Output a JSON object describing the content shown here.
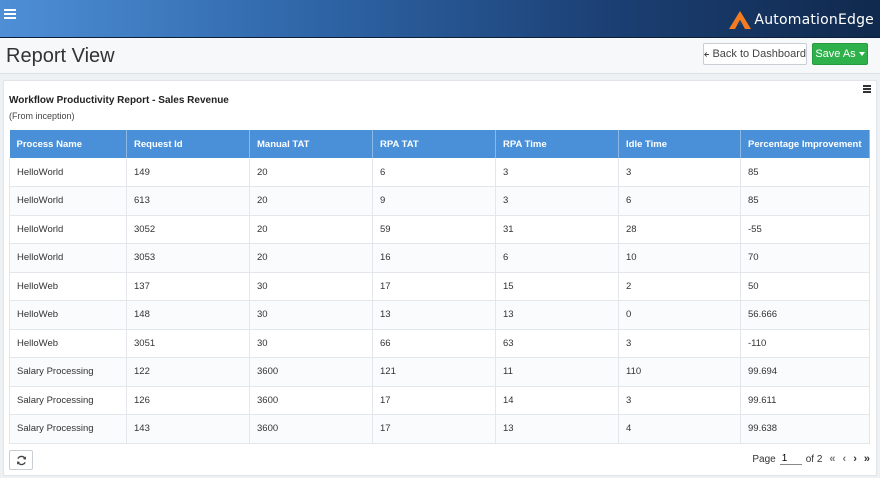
{
  "topbar": {
    "brand": "AutomationEdge",
    "brand_color": "#f47b20"
  },
  "header": {
    "title": "Report View",
    "back_label": "Back to Dashboard",
    "save_label": "Save As"
  },
  "report": {
    "title": "Workflow Productivity Report - Sales Revenue",
    "subtitle": "(From inception)",
    "columns": [
      "Process Name",
      "Request Id",
      "Manual TAT",
      "RPA TAT",
      "RPA Time",
      "Idle Time",
      "Percentage Improvement"
    ],
    "rows": [
      [
        "HelloWorld",
        "149",
        "20",
        "6",
        "3",
        "3",
        "85"
      ],
      [
        "HelloWorld",
        "613",
        "20",
        "9",
        "3",
        "6",
        "85"
      ],
      [
        "HelloWorld",
        "3052",
        "20",
        "59",
        "31",
        "28",
        "-55"
      ],
      [
        "HelloWorld",
        "3053",
        "20",
        "16",
        "6",
        "10",
        "70"
      ],
      [
        "HelloWeb",
        "137",
        "30",
        "17",
        "15",
        "2",
        "50"
      ],
      [
        "HelloWeb",
        "148",
        "30",
        "13",
        "13",
        "0",
        "56.666"
      ],
      [
        "HelloWeb",
        "3051",
        "30",
        "66",
        "63",
        "3",
        "-110"
      ],
      [
        "Salary Processing",
        "122",
        "3600",
        "121",
        "11",
        "110",
        "99.694"
      ],
      [
        "Salary Processing",
        "126",
        "3600",
        "17",
        "14",
        "3",
        "99.611"
      ],
      [
        "Salary Processing",
        "143",
        "3600",
        "17",
        "13",
        "4",
        "99.638"
      ]
    ],
    "header_color": "#4a90d9"
  },
  "pager": {
    "page_label": "Page",
    "current_page": "1",
    "of_label": "of 2",
    "first": "«",
    "prev": "‹",
    "next": "›",
    "last": "»"
  }
}
